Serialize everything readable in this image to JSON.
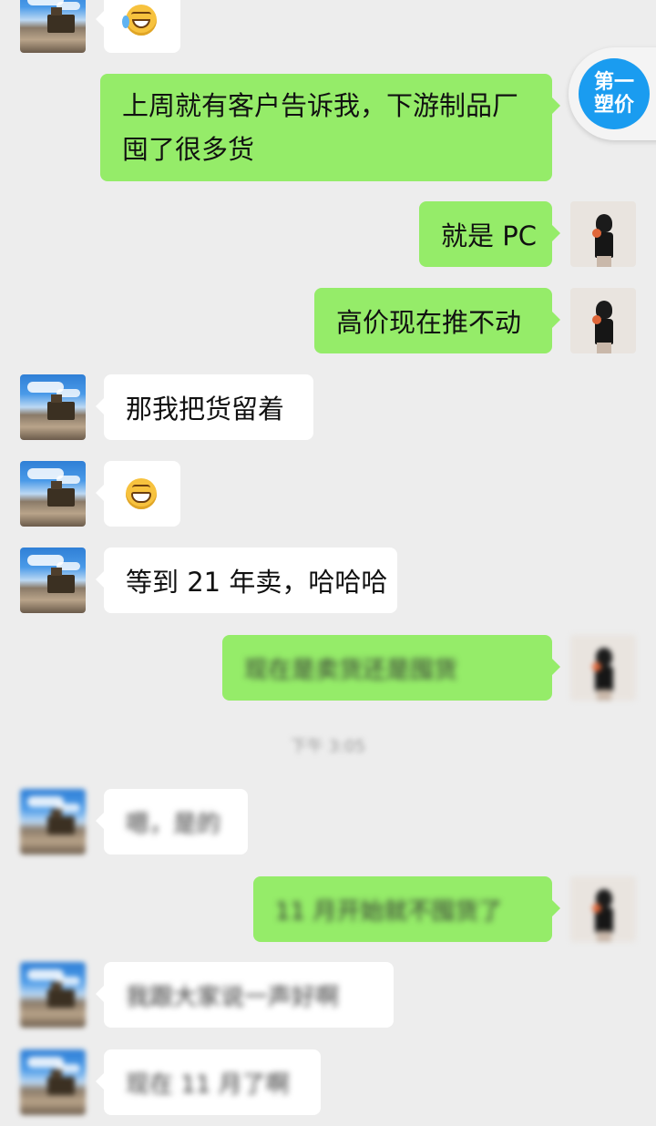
{
  "messages": [
    {
      "side": "in",
      "avatar": "train-avatar",
      "emoji": "laughing-tears-emoji"
    },
    {
      "side": "out",
      "text": "上周就有客户告诉我，下游制品厂囤了很多货"
    },
    {
      "side": "out",
      "avatar": "girl-avatar",
      "text": "就是 PC"
    },
    {
      "side": "out",
      "avatar": "girl-avatar",
      "text": "高价现在推不动"
    },
    {
      "side": "in",
      "avatar": "train-avatar",
      "text": "那我把货留着"
    },
    {
      "side": "in",
      "avatar": "train-avatar",
      "emoji": "grinning-emoji"
    },
    {
      "side": "in",
      "avatar": "train-avatar",
      "text": "等到 21 年卖，哈哈哈"
    },
    {
      "side": "out",
      "avatar": "girl-avatar",
      "text": "现在是卖货还是囤货"
    },
    {
      "side": "in",
      "avatar": "train-avatar",
      "text": "嗯，是的"
    },
    {
      "side": "out",
      "avatar": "girl-avatar",
      "text": "11 月开始就不囤货了"
    },
    {
      "side": "in",
      "avatar": "train-avatar",
      "text": "我跟大家说一声好啊"
    },
    {
      "side": "in",
      "avatar": "train-avatar",
      "text": "现在 11 月了啊"
    }
  ],
  "timestamp": "下午 3:05",
  "badge": {
    "line1": "第一",
    "line2": "塑价"
  },
  "colors": {
    "background": "#ededed",
    "outgoing": "#95ec69",
    "incoming": "#ffffff",
    "badge": "#1a9cf0"
  }
}
